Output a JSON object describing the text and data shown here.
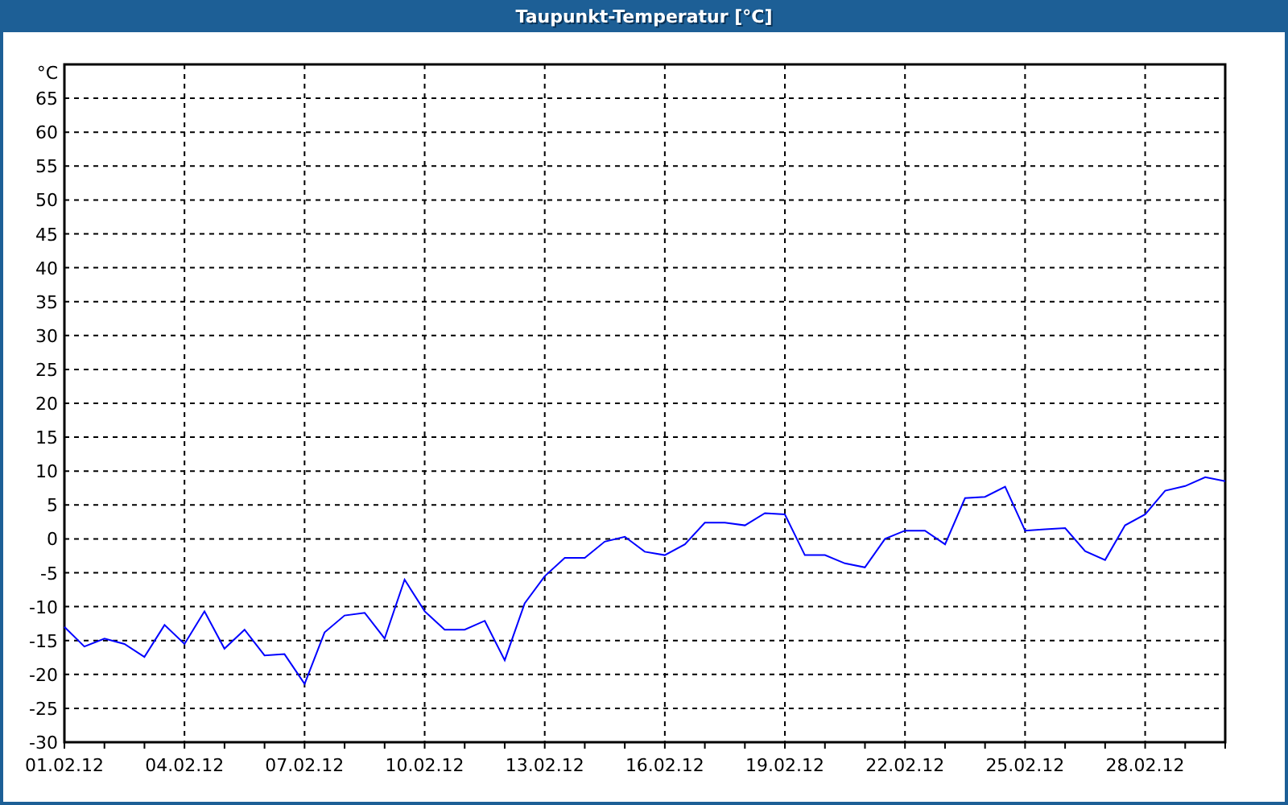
{
  "window": {
    "title": "Taupunkt-Temperatur [°C]"
  },
  "chart": {
    "chart_data": {
      "type": "line",
      "ylabel": "°C",
      "categories": [
        "01.02.12",
        null,
        null,
        null,
        null,
        null,
        "04.02.12",
        null,
        null,
        null,
        null,
        null,
        "07.02.12",
        null,
        null,
        null,
        null,
        null,
        "10.02.12",
        null,
        null,
        null,
        null,
        null,
        "13.02.12",
        null,
        null,
        null,
        null,
        null,
        "16.02.12",
        null,
        null,
        null,
        null,
        null,
        "19.02.12",
        null,
        null,
        null,
        null,
        null,
        "22.02.12",
        null,
        null,
        null,
        null,
        null,
        "25.02.12",
        null,
        null,
        null,
        null,
        null,
        "28.02.12",
        null,
        null,
        null,
        null
      ],
      "series": [
        {
          "color": "#0000ff",
          "values": [
            -13,
            -15.9,
            -14.7,
            -15.5,
            -17.4,
            -12.7,
            -15.5,
            -10.7,
            -16.2,
            -13.4,
            -17.2,
            -17,
            -21.4,
            -13.8,
            -11.3,
            -10.9,
            -14.7,
            -6,
            -10.7,
            -13.4,
            -13.4,
            -12.1,
            -17.9,
            -9.5,
            -5.5,
            -2.8,
            -2.8,
            -0.4,
            0.3,
            -1.9,
            -2.4,
            -0.8,
            2.4,
            2.4,
            2,
            3.8,
            3.6,
            -2.4,
            -2.4,
            -3.6,
            -4.2,
            0,
            1.2,
            1.2,
            -0.8,
            6,
            6.2,
            7.7,
            1.2,
            1.4,
            1.6,
            -1.8,
            -3.1,
            2,
            3.6,
            7.1,
            7.8,
            9.1,
            8.5
          ]
        }
      ],
      "grid": true,
      "ylim": [
        -30,
        70
      ],
      "yticks": [
        -30,
        -25,
        -20,
        -15,
        -10,
        -5,
        0,
        5,
        10,
        15,
        20,
        25,
        30,
        35,
        40,
        45,
        50,
        55,
        60,
        65
      ]
    }
  }
}
